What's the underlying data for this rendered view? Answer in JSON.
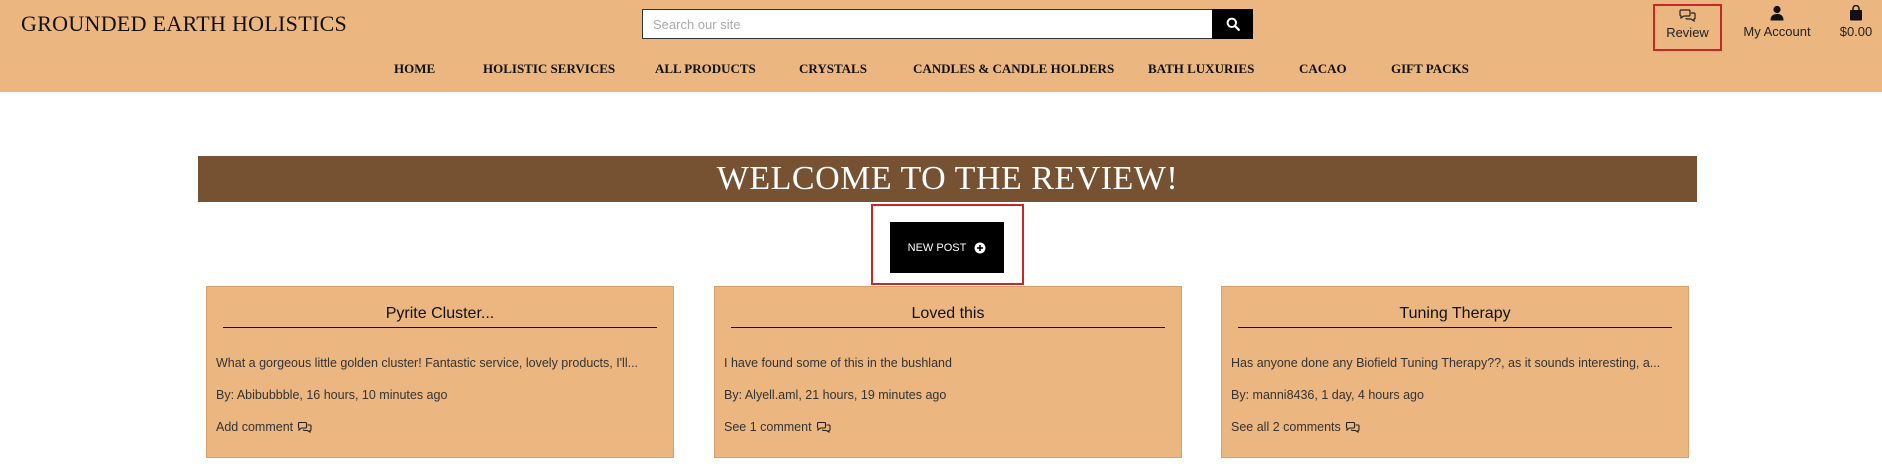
{
  "header": {
    "logo": "GROUNDED EARTH HOLISTICS",
    "search": {
      "placeholder": "Search our site",
      "value": ""
    },
    "utility": {
      "review_label": "Review",
      "account_label": "My Account",
      "cart_label": "$0.00"
    }
  },
  "nav": {
    "items": [
      {
        "label": "HOME"
      },
      {
        "label": "HOLISTIC SERVICES"
      },
      {
        "label": "ALL PRODUCTS"
      },
      {
        "label": "CRYSTALS"
      },
      {
        "label": "CANDLES & CANDLE HOLDERS"
      },
      {
        "label": "BATH LUXURIES"
      },
      {
        "label": "CACAO"
      },
      {
        "label": "GIFT PACKS"
      }
    ]
  },
  "main": {
    "heading": "WELCOME TO THE REVIEW!",
    "new_post_label": "NEW POST",
    "posts": [
      {
        "title": "Pyrite Cluster...",
        "excerpt": "What a gorgeous little golden cluster! Fantastic service, lovely products, I'll...",
        "byline": "By: Abibubbble, 16 hours, 10 minutes ago",
        "comments_label": "Add comment"
      },
      {
        "title": "Loved this",
        "excerpt": "I have found some of this in the bushland",
        "byline": "By: Alyell.aml, 21 hours, 19 minutes ago",
        "comments_label": "See 1 comment"
      },
      {
        "title": "Tuning Therapy",
        "excerpt": "Has anyone done any Biofield Tuning Therapy??, as it sounds interesting, a...",
        "byline": "By: manni8436, 1 day, 4 hours ago",
        "comments_label": "See all 2 comments"
      }
    ]
  },
  "colors": {
    "header_bg": "#ecb680",
    "banner_bg": "#765233",
    "highlight_border": "#c62828",
    "button_bg": "#000000"
  },
  "icons": [
    "search-icon",
    "chat-icon",
    "user-icon",
    "bag-icon",
    "plus-circle-icon",
    "comment-icon"
  ]
}
